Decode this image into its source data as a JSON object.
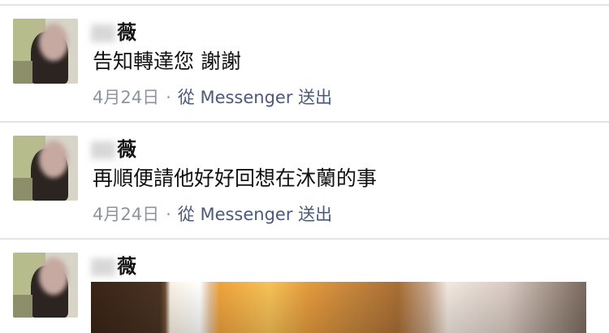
{
  "messages": [
    {
      "sender": "薇",
      "text": "告知轉達您 謝謝",
      "date": "4月24日",
      "separator": "·",
      "via": "從 Messenger 送出"
    },
    {
      "sender": "薇",
      "text": "再順便請他好好回想在沐蘭的事",
      "date": "4月24日",
      "separator": "·",
      "via": "從 Messenger 送出"
    },
    {
      "sender": "薇"
    }
  ],
  "colors": {
    "meta_gray": "#8d949e",
    "link_blue": "#4b5a7a",
    "divider": "#e3e5e8"
  }
}
